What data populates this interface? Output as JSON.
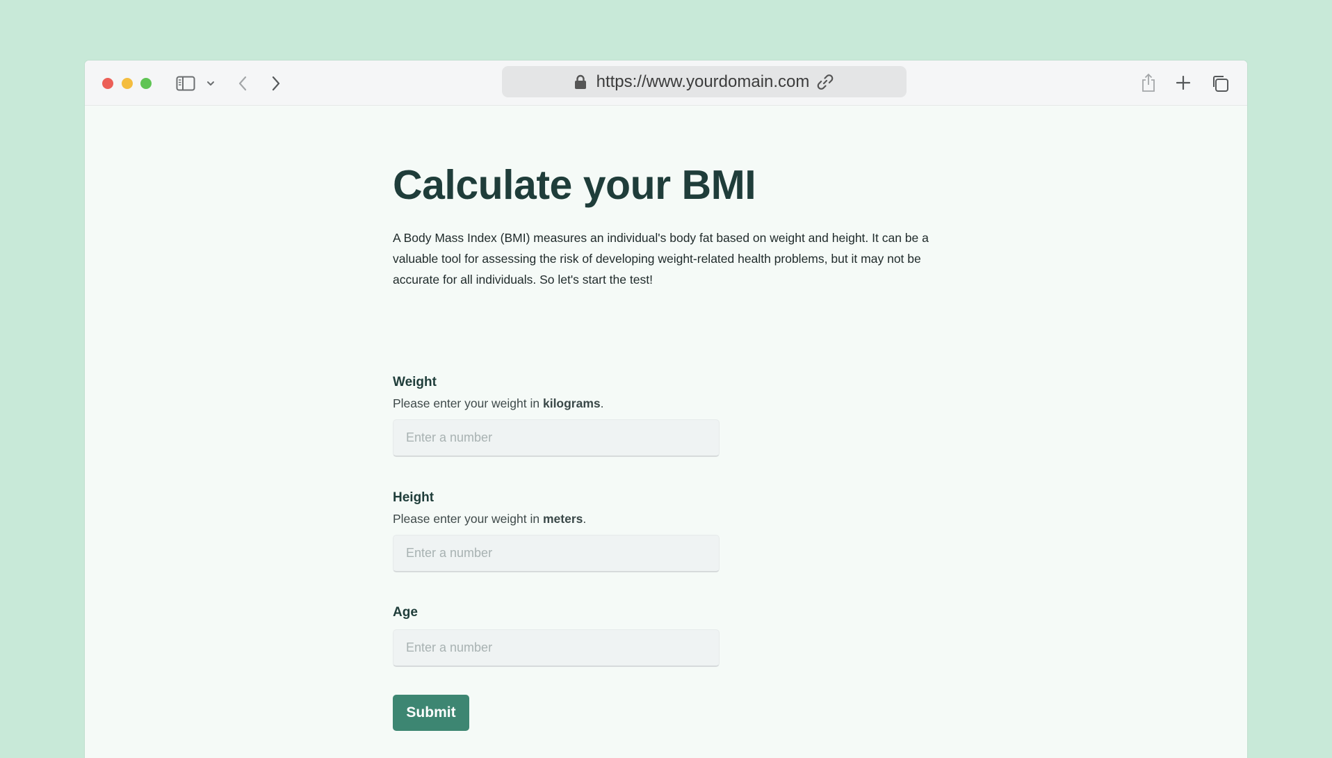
{
  "browser": {
    "url": "https://www.yourdomain.com",
    "icons": [
      "sidebar-icon",
      "chevron-down-icon",
      "back-arrow-icon",
      "forward-arrow-icon",
      "lock-icon",
      "link-icon",
      "share-icon",
      "new-tab-icon",
      "tabs-overview-icon"
    ]
  },
  "page": {
    "title": "Calculate your BMI",
    "intro": "A Body Mass Index (BMI) measures an individual's body fat based on weight and height. It can be a valuable tool for assessing the risk of developing weight-related health problems, but it may not be accurate for all individuals. So let's start the test!"
  },
  "form": {
    "weight": {
      "label": "Weight",
      "help_prefix": "Please enter your weight in ",
      "help_unit": "kilograms",
      "help_suffix": ".",
      "placeholder": "Enter a number",
      "value": ""
    },
    "height": {
      "label": "Height",
      "help_prefix": "Please enter your weight in ",
      "help_unit": "meters",
      "help_suffix": ".",
      "placeholder": "Enter a number",
      "value": ""
    },
    "age": {
      "label": "Age",
      "placeholder": "Enter a number",
      "value": ""
    },
    "submit_label": "Submit"
  },
  "colors": {
    "background": "#c8e9d8",
    "page": "#f5faf7",
    "heading": "#1f3d3a",
    "accent": "#3d8672",
    "input_bg": "#eff3f3"
  }
}
